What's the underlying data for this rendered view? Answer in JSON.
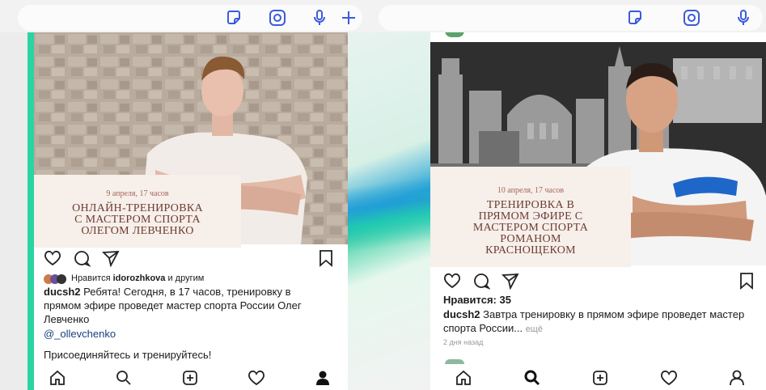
{
  "top_bars": {
    "left": {
      "icons": [
        "sticker-icon",
        "camera-icon",
        "mic-icon",
        "plus-icon"
      ]
    },
    "right": {
      "icons": [
        "sticker-icon",
        "camera-icon",
        "mic-icon"
      ]
    }
  },
  "post_left": {
    "date": "9 апреля, 17 часов",
    "title_lines": [
      "ОНЛАЙН-ТРЕНИРОВКА",
      "С МАСТЕРОМ СПОРТА",
      "ОЛЕГОМ ЛЕВЧЕНКО"
    ],
    "likes_prefix": "Нравится",
    "likes_user": "idorozhkova",
    "likes_suffix": "и другим",
    "username": "ducsh2",
    "caption": "Ребята! Сегодня, в 17 часов, тренировку в прямом эфире проведет мастер спорта России Олег Левченко",
    "mention": "@_ollevchenko",
    "caption_2": "Присоединяйтесь и тренируйтесь!"
  },
  "post_right": {
    "date": "10 апреля, 17 часов",
    "title_lines": [
      "ТРЕНИРОВКА В",
      "ПРЯМОМ ЭФИРЕ С",
      "МАСТЕРОМ СПОРТА",
      "РОМАНОМ",
      "КРАСНОЩЕКОМ"
    ],
    "likes": "Нравится: 35",
    "username": "ducsh2",
    "caption": "Завтра тренировку в прямом эфире проведет мастер спорта России...",
    "more": "ещё",
    "time": "2 дня назад"
  },
  "colors": {
    "accent": "#3b5bdc",
    "green_edge": "#2bd4a2"
  }
}
